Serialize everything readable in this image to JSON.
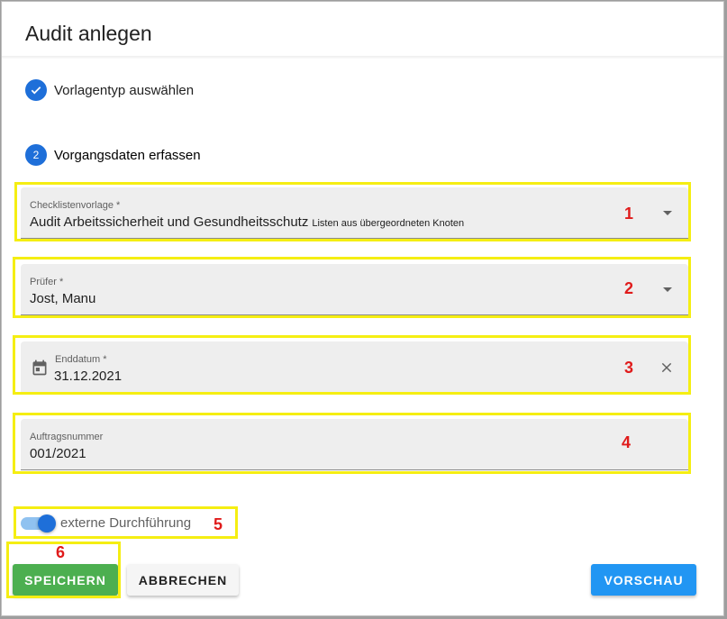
{
  "dialog": {
    "title": "Audit anlegen"
  },
  "steps": [
    {
      "label": "Vorlagentyp auswählen",
      "state": "done",
      "icon": "check-icon"
    },
    {
      "label": "Vorgangsdaten erfassen",
      "number": "2",
      "state": "active"
    }
  ],
  "fields": {
    "checklist": {
      "label": "Checklistenvorlage *",
      "value": "Audit Arbeitssicherheit und Gesundheitsschutz",
      "hint": "Listen aus übergeordneten Knoten"
    },
    "auditor": {
      "label": "Prüfer *",
      "value": "Jost, Manu"
    },
    "end_date": {
      "label": "Enddatum *",
      "value": "31.12.2021"
    },
    "order_number": {
      "label": "Auftragsnummer",
      "value": "001/2021"
    }
  },
  "toggle": {
    "label": "externe Durchführung",
    "checked": true
  },
  "buttons": {
    "save": "SPEICHERN",
    "cancel": "ABBRECHEN",
    "preview": "VORSCHAU"
  },
  "annotations": [
    "1",
    "2",
    "3",
    "4",
    "5",
    "6"
  ],
  "colors": {
    "primary": "#1e6fd9",
    "save": "#4caf50",
    "preview": "#2196f3",
    "highlight": "#f5ee12",
    "annotation": "#e01b1b"
  }
}
